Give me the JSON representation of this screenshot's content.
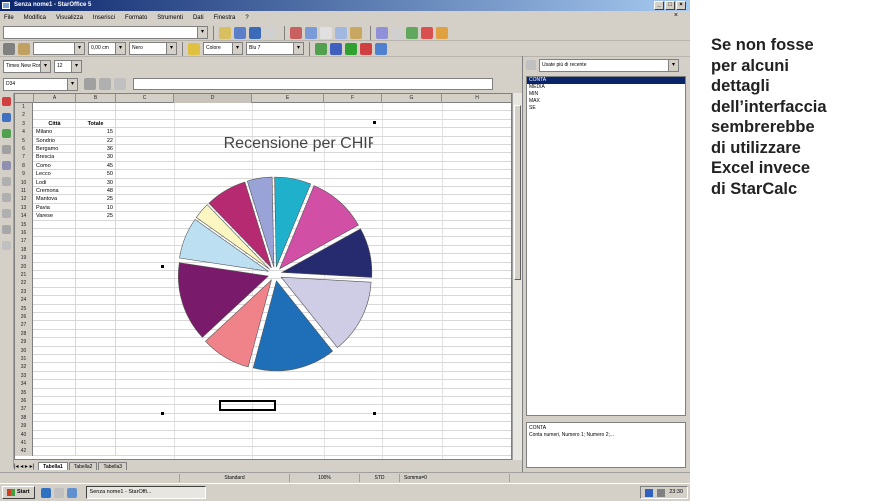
{
  "window": {
    "title": "Senza nome1 - StarOffice 5"
  },
  "menu": [
    "File",
    "Modifica",
    "Visualizza",
    "Inserisci",
    "Formato",
    "Strumenti",
    "Dati",
    "Finestra",
    "?"
  ],
  "toolbar": {
    "font_name": "Times New Roman",
    "font_size": "12",
    "line_width": "0,00 cm",
    "line_color": "Nero",
    "area_type": "Colore",
    "area_color": "Blu 7"
  },
  "formula": {
    "cell_ref": "D34"
  },
  "columns": [
    "A",
    "B",
    "C",
    "D",
    "E",
    "F",
    "G",
    "H"
  ],
  "table": {
    "headers": [
      "Città",
      "Totale"
    ],
    "rows": [
      [
        "Milano",
        "15"
      ],
      [
        "Sondrio",
        "22"
      ],
      [
        "Bergamo",
        "36"
      ],
      [
        "Brescia",
        "30"
      ],
      [
        "Como",
        "45"
      ],
      [
        "Lecco",
        "50"
      ],
      [
        "Lodi",
        "30"
      ],
      [
        "Cremona",
        "48"
      ],
      [
        "Mantova",
        "25"
      ],
      [
        "Pavia",
        "10"
      ],
      [
        "Varese",
        "25"
      ]
    ]
  },
  "row_numbers": [
    "1",
    "2",
    "3",
    "4",
    "5",
    "6",
    "7",
    "8",
    "9",
    "10",
    "11",
    "12",
    "13",
    "14",
    "15",
    "16",
    "17",
    "18",
    "19",
    "20",
    "21",
    "22",
    "23",
    "24",
    "25",
    "26",
    "27",
    "28",
    "29",
    "30",
    "31",
    "32",
    "33",
    "34",
    "35",
    "36",
    "37",
    "38",
    "39",
    "40",
    "41",
    "42"
  ],
  "chart_data": {
    "type": "pie",
    "title": "Recensione per CHIP",
    "categories": [
      "Milano",
      "Sondrio",
      "Bergamo",
      "Brescia",
      "Como",
      "Lecco",
      "Lodi",
      "Cremona",
      "Mantova",
      "Pavia",
      "Varese"
    ],
    "values": [
      15,
      22,
      36,
      30,
      45,
      50,
      30,
      48,
      25,
      10,
      25
    ],
    "colors": [
      "#9aa3d8",
      "#1fb0cc",
      "#d24fa6",
      "#262a6e",
      "#cfcde6",
      "#1f6fb8",
      "#f0828a",
      "#7a1a6a",
      "#bce0f2",
      "#fbf6c2",
      "#b52a70"
    ]
  },
  "sheet_tabs": [
    "Tabella1",
    "Tabella2",
    "Tabella3"
  ],
  "status": {
    "zoom": "100%",
    "mode": "STD",
    "sum": "Somma=0",
    "page": "Standard"
  },
  "taskbar": {
    "start_label": "Start",
    "task": "Senza nome1 - StarOffi...",
    "clock": "23:30"
  },
  "side_panel": {
    "dropdown": "Usate più di recente",
    "functions": [
      "CONTA",
      "MEDIA",
      "MIN",
      "MAX",
      "SE"
    ],
    "desc": "Conta numeri, Numero 1; Numero 2;..."
  },
  "caption": {
    "lines": [
      "Se non fosse",
      "per alcuni",
      "dettagli",
      "dell’interfaccia",
      "sembrerebbe",
      "di utilizzare",
      "Excel invece",
      "di StarCalc"
    ]
  }
}
